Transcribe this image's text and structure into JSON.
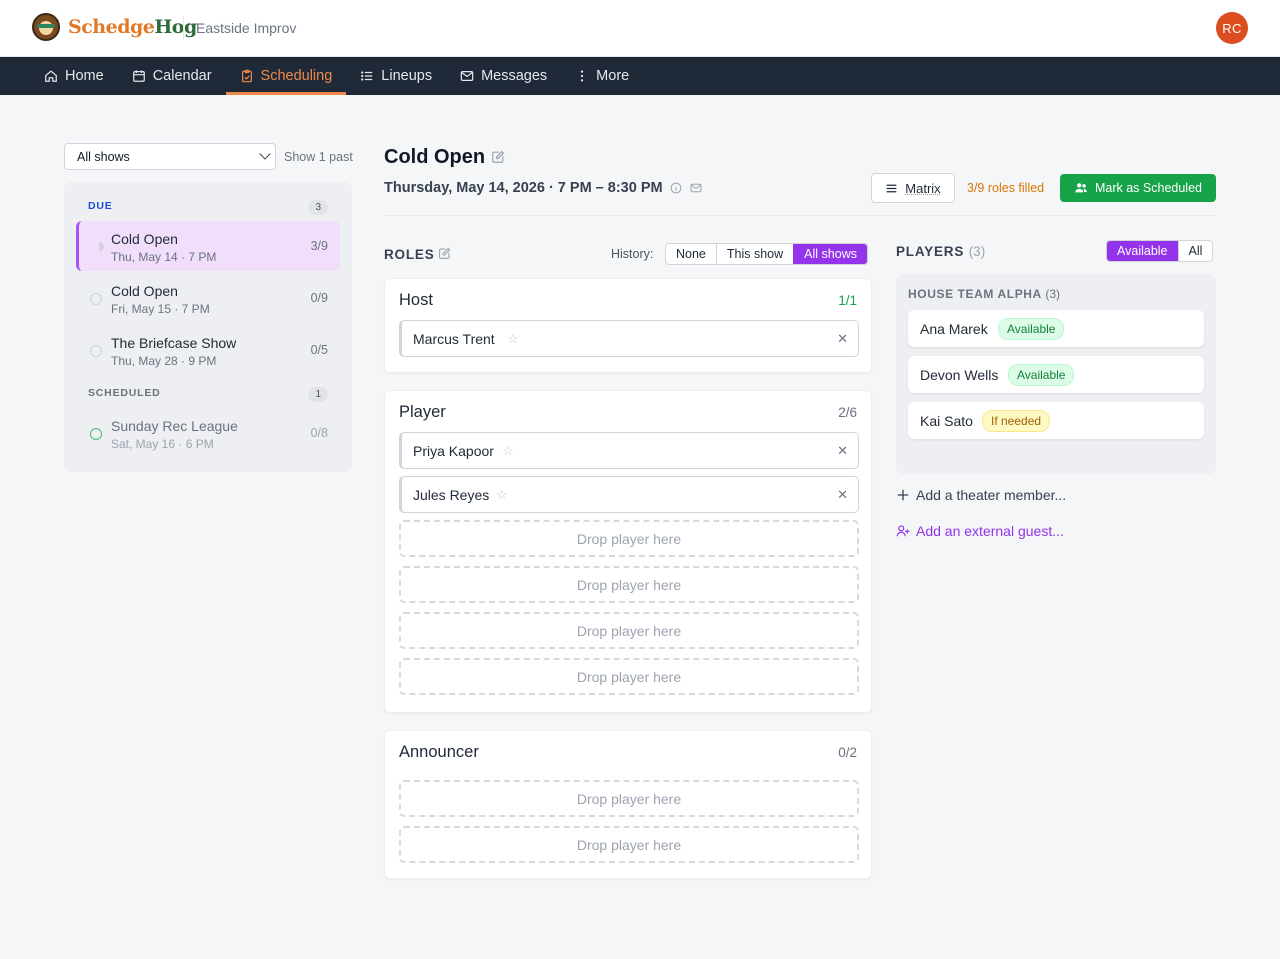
{
  "header": {
    "logo_part1": "Schedge",
    "logo_part2": "Hog",
    "org_name": "Eastside Improv",
    "avatar_initials": "RC"
  },
  "nav": {
    "items": [
      {
        "label": "Home",
        "icon": "home-icon"
      },
      {
        "label": "Calendar",
        "icon": "calendar-icon"
      },
      {
        "label": "Scheduling",
        "icon": "clipboard-icon",
        "active": true
      },
      {
        "label": "Lineups",
        "icon": "list-icon"
      },
      {
        "label": "Messages",
        "icon": "mail-icon"
      },
      {
        "label": "More",
        "icon": "more-vertical-icon"
      }
    ]
  },
  "sidebar": {
    "filter_value": "All shows",
    "show_past": "Show 1 past",
    "due_label": "DUE",
    "due_count": "3",
    "scheduled_label": "SCHEDULED",
    "scheduled_count": "1",
    "due_items": [
      {
        "title": "Cold Open",
        "sub": "Thu, May 14 · 7 PM",
        "frac": "3/9"
      },
      {
        "title": "Cold Open",
        "sub": "Fri, May 15 · 7 PM",
        "frac": "0/9"
      },
      {
        "title": "The Briefcase Show",
        "sub": "Thu, May 28 · 9 PM",
        "frac": "0/5"
      }
    ],
    "scheduled_items": [
      {
        "title": "Sunday Rec League",
        "sub": "Sat, May 16 · 6 PM",
        "frac": "0/8"
      }
    ]
  },
  "main": {
    "title": "Cold Open",
    "date": "Thursday, May 14, 2026 · 7 PM – 8:30 PM",
    "matrix_label": "Matrix",
    "roles_filled": "3/9 roles filled",
    "mark_label": "Mark as Scheduled"
  },
  "roles": {
    "label": "ROLES",
    "history_label": "History:",
    "history_options": [
      "None",
      "This show",
      "All shows"
    ],
    "empty_slot_label": "Drop player here",
    "cards": [
      {
        "name": "Host",
        "frac": "1/1",
        "players": [
          "Marcus Trent"
        ]
      },
      {
        "name": "Player",
        "frac": "2/6",
        "players": [
          "Priya Kapoor",
          "Jules Reyes"
        ]
      },
      {
        "name": "Announcer",
        "frac": "0/2",
        "players": []
      }
    ]
  },
  "players": {
    "label": "PLAYERS",
    "count": "(3)",
    "toggle": [
      "Available",
      "All"
    ],
    "team_name": "HOUSE TEAM ALPHA",
    "team_count": "(3)",
    "list": [
      {
        "name": "Ana Marek",
        "status": "Available"
      },
      {
        "name": "Devon Wells",
        "status": "Available"
      },
      {
        "name": "Kai Sato",
        "status": "If needed"
      }
    ],
    "add_member": "Add a theater member...",
    "add_guest": "Add an external guest..."
  },
  "colors": {
    "accent": "#9333ea",
    "nav_bg": "#1f2937",
    "nav_active": "#f08a4b",
    "success": "#16a34a",
    "warning": "#d97706"
  }
}
